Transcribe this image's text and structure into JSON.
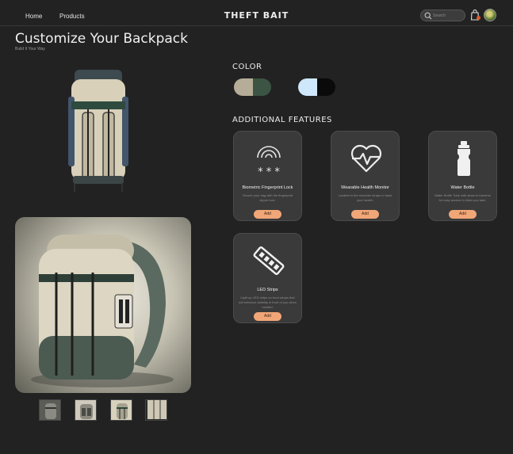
{
  "header": {
    "nav": [
      {
        "label": "Home"
      },
      {
        "label": "Products"
      }
    ],
    "brand": "THEFT BAIT",
    "search_placeholder": "Search"
  },
  "page": {
    "title": "Customize Your Backpack",
    "subtitle": "Build It Your Way"
  },
  "color_section": {
    "heading": "COLOR",
    "swatches": [
      {
        "name": "beige-green",
        "colors": [
          "#b5ad97",
          "#3c5443"
        ]
      },
      {
        "name": "light-blue-black",
        "colors": [
          "#cfe7fb",
          "#0a0a0a"
        ]
      }
    ]
  },
  "features_section": {
    "heading": "ADDITIONAL FEATURES",
    "features": [
      {
        "title": "Biometric Fingerprint Lock",
        "description": "Secure your bag with the fingerprint zipper lock.",
        "button": "Add",
        "icon": "fingerprint-lock-icon"
      },
      {
        "title": "Wearable Health Monitor",
        "description": "Located in the shoulder straps to track your health.",
        "button": "Add",
        "icon": "heart-monitor-icon"
      },
      {
        "title": "Water Bottle",
        "description": "Water Bottle Tube with straw to traverse for easy access to hikes you take.",
        "button": "Add",
        "icon": "water-bottle-icon"
      },
      {
        "title": "LED Strips",
        "description": "Light up LED strips on front straps that will enhance visibility in front of you when needed.",
        "button": "Add",
        "icon": "led-strip-icon"
      }
    ]
  },
  "colors": {
    "accent": "#f1a677",
    "background": "#222222",
    "card": "#3a3a3a"
  }
}
